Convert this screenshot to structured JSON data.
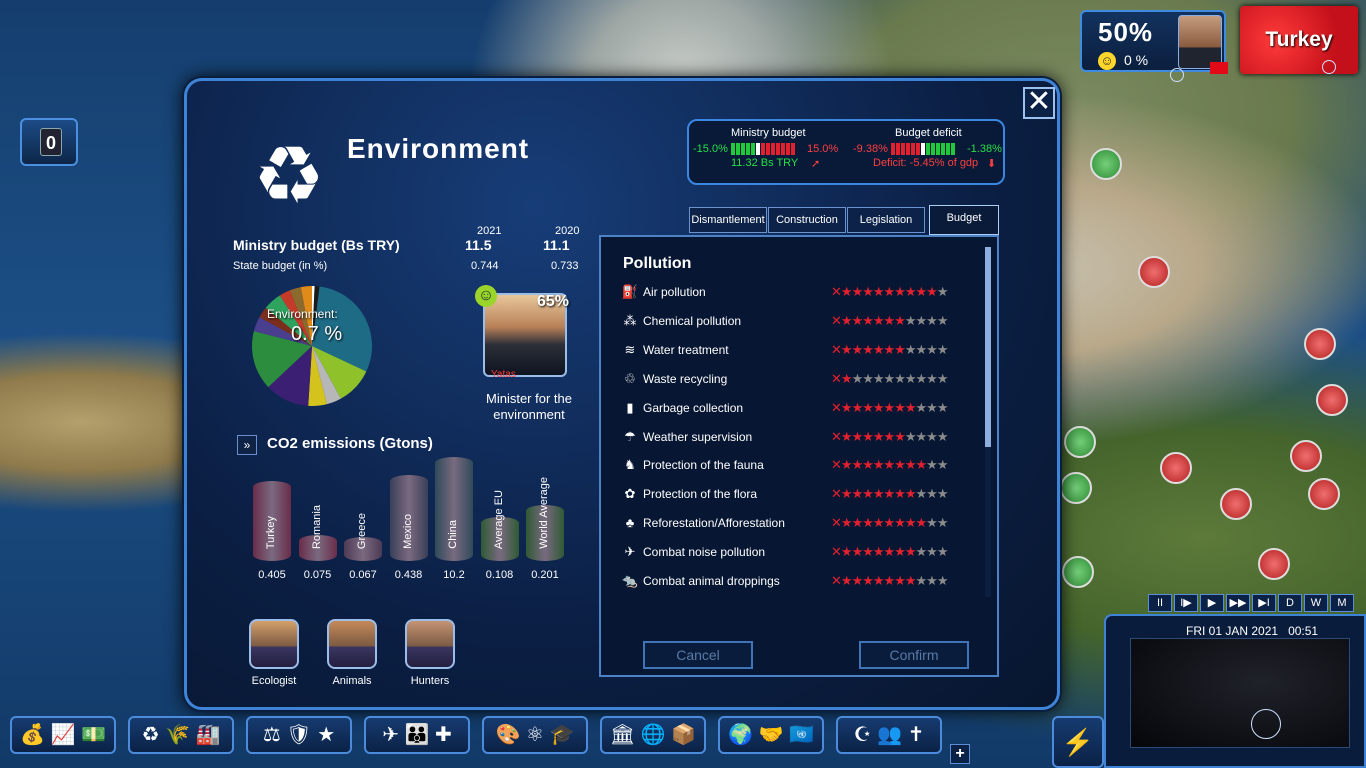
{
  "hud": {
    "approval_pct": "50%",
    "happiness_pct": "0 %",
    "country": "Turkey",
    "notifications": "0"
  },
  "panel": {
    "title": "Environment",
    "close_label": "✕",
    "budget_box": {
      "ministry_label": "Ministry budget",
      "ministry_min": "-15.0%",
      "ministry_max": "15.0%",
      "ministry_value": "11.32 Bs TRY",
      "deficit_label": "Budget deficit",
      "deficit_min": "-9.38%",
      "deficit_max": "-1.38%",
      "deficit_value": "Deficit: -5.45% of gdp"
    },
    "ministry_budget": {
      "title": "Ministry budget (Bs TRY)",
      "years": [
        "2021",
        "2020"
      ],
      "values": [
        "11.5",
        "11.1"
      ],
      "state_label": "State budget (in %)",
      "state_values": [
        "0.744",
        "0.733"
      ]
    },
    "pie": {
      "label": "Environment:",
      "value": "0.7 %",
      "slices": [
        {
          "share": 0.32,
          "color": "#1e6b86"
        },
        {
          "share": 0.1,
          "color": "#8fc12b"
        },
        {
          "share": 0.04,
          "color": "#b7b7b7"
        },
        {
          "share": 0.05,
          "color": "#d4c21d"
        },
        {
          "share": 0.12,
          "color": "#3a1f73"
        },
        {
          "share": 0.16,
          "color": "#2c8d3f"
        },
        {
          "share": 0.04,
          "color": "#4a3e8e"
        },
        {
          "share": 0.03,
          "color": "#7c2e1c"
        },
        {
          "share": 0.05,
          "color": "#2ea35e"
        },
        {
          "share": 0.03,
          "color": "#c43b2a"
        },
        {
          "share": 0.03,
          "color": "#8c6a2e"
        },
        {
          "share": 0.03,
          "color": "#e08a19"
        },
        {
          "share": 0.007,
          "color": "#ffffff"
        },
        {
          "share": 0.013,
          "color": "#1a1a1a"
        }
      ]
    },
    "minister": {
      "approval": "65%",
      "name": "Yatas",
      "role": "Minister for the environment"
    },
    "co2": {
      "title": "CO2 emissions (Gtons)",
      "items": [
        {
          "label": "Turkey",
          "value": "0.405",
          "color": "#6a2c4a"
        },
        {
          "label": "Romania",
          "value": "0.075",
          "color": "#6a2c4a"
        },
        {
          "label": "Greece",
          "value": "0.067",
          "color": "#4d3a55"
        },
        {
          "label": "Mexico",
          "value": "0.438",
          "color": "#3a3f58"
        },
        {
          "label": "China",
          "value": "10.2",
          "color": "#2f4a5a"
        },
        {
          "label": "Average EU",
          "value": "0.108",
          "color": "#2f5a35"
        },
        {
          "label": "World Average",
          "value": "0.201",
          "color": "#2f5a35"
        }
      ]
    },
    "groups": [
      {
        "label": "Ecologist"
      },
      {
        "label": "Animals"
      },
      {
        "label": "Hunters"
      }
    ],
    "tabs": [
      "Dismantlement",
      "Construction",
      "Legislation",
      "Budget"
    ],
    "pollution": {
      "title": "Pollution",
      "rows": [
        {
          "icon": "⛽",
          "label": "Air pollution",
          "stars": 9
        },
        {
          "icon": "⁂",
          "label": "Chemical pollution",
          "stars": 6
        },
        {
          "icon": "≋",
          "label": "Water treatment",
          "stars": 6
        },
        {
          "icon": "♲",
          "label": "Waste recycling",
          "stars": 1
        },
        {
          "icon": "▮",
          "label": "Garbage collection",
          "stars": 7
        },
        {
          "icon": "☂",
          "label": "Weather supervision",
          "stars": 6
        },
        {
          "icon": "♞",
          "label": "Protection of the fauna",
          "stars": 8
        },
        {
          "icon": "✿",
          "label": "Protection of the flora",
          "stars": 7
        },
        {
          "icon": "♣",
          "label": "Reforestation/Afforestation",
          "stars": 8
        },
        {
          "icon": "✈",
          "label": "Combat noise pollution",
          "stars": 7
        },
        {
          "icon": "🐀",
          "label": "Combat animal droppings",
          "stars": 7
        }
      ]
    },
    "cancel_label": "Cancel",
    "confirm_label": "Confirm"
  },
  "time": {
    "date": "FRI 01 JAN 2021",
    "clock": "00:51",
    "buttons": [
      "II",
      "I▶",
      "▶",
      "▶▶",
      "▶I",
      "D",
      "W",
      "M"
    ]
  },
  "bottom_bar": [
    {
      "icons": "💰 📈 💵"
    },
    {
      "icons": "♻ 🌾 🏭"
    },
    {
      "icons": "⚖ 🛡 ★"
    },
    {
      "icons": "✈ 👪 ✚"
    },
    {
      "icons": "🎨 ⚛ 🎓"
    },
    {
      "icons": "🏛 🌐 📦"
    },
    {
      "icons": "🌍 🤝 🇺🇳"
    },
    {
      "icons": "☪ 👥 ✝"
    }
  ]
}
